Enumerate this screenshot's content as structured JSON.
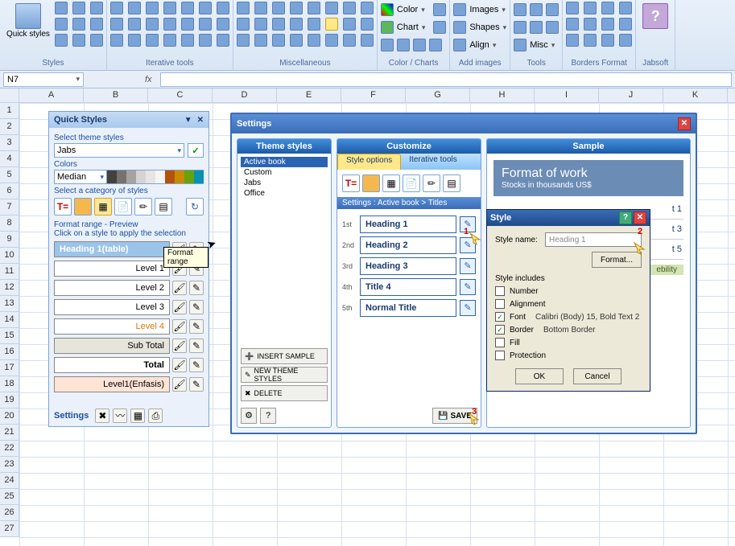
{
  "ribbon": {
    "groups": [
      {
        "label": "Styles",
        "big": "Quick styles"
      },
      {
        "label": "Iterative tools"
      },
      {
        "label": "Miscellaneous"
      },
      {
        "label": "Color / Charts",
        "rows": [
          "Color",
          "Chart",
          "Align"
        ]
      },
      {
        "label": "Add images",
        "rows": [
          "Images",
          "Shapes",
          "Align"
        ]
      },
      {
        "label": "Tools",
        "rows": [
          "Misc"
        ]
      },
      {
        "label": "Borders Format"
      },
      {
        "label": "Jabsoft"
      }
    ]
  },
  "formula": {
    "cell": "N7",
    "fx": "fx"
  },
  "grid": {
    "cols": [
      "A",
      "B",
      "C",
      "D",
      "E",
      "F",
      "G",
      "H",
      "I",
      "J",
      "K"
    ],
    "rows": 27
  },
  "quickStyles": {
    "title": "Quick Styles",
    "select_theme_label": "Select theme styles",
    "theme_value": "Jabs",
    "colors_label": "Colors",
    "colors_value": "Median",
    "swatches": [
      "#44403c",
      "#78716c",
      "#a8a29e",
      "#d6d3d1",
      "#e7e5e4",
      "#f5f5f4",
      "#b45309",
      "#ca8a04",
      "#65a30d",
      "#0891b2"
    ],
    "category_label": "Select a category of styles",
    "tooltip": "Format range",
    "preview_label": "Format range - Preview",
    "preview_sub": "Click on a style to apply the selection",
    "styles": [
      {
        "name": "Heading 1(table)",
        "sel": true,
        "bg": "#9cc3e8",
        "color": "#fff",
        "align": "left",
        "bold": true
      },
      {
        "name": "Level 1",
        "bg": "#fff",
        "color": "#000"
      },
      {
        "name": "Level 2",
        "bg": "#fff",
        "color": "#000"
      },
      {
        "name": "Level 3",
        "bg": "#fff",
        "color": "#000"
      },
      {
        "name": "Level 4",
        "bg": "#fff",
        "color": "#d97706"
      },
      {
        "name": "Sub Total",
        "bg": "#e5e5dc",
        "color": "#000"
      },
      {
        "name": "Total",
        "bg": "#fff",
        "color": "#000",
        "bold": true
      },
      {
        "name": "Level1(Enfasis)",
        "bg": "#ffe4d6",
        "color": "#000"
      }
    ],
    "settings_label": "Settings"
  },
  "settings": {
    "title": "Settings",
    "panes": {
      "left": "Theme styles",
      "mid": "Customize",
      "right": "Sample"
    },
    "themes": [
      "Active book",
      "Custom",
      "Jabs",
      "Office"
    ],
    "left_buttons": [
      "INSERT SAMPLE",
      "NEW THEME STYLES",
      "DELETE"
    ],
    "tabs": [
      "Style options",
      "Iterative tools"
    ],
    "breadcrumb": "Settings : Active book > Titles",
    "headings": [
      {
        "ord": "1st",
        "val": "Heading 1"
      },
      {
        "ord": "2nd",
        "val": "Heading 2"
      },
      {
        "ord": "3rd",
        "val": "Heading 3"
      },
      {
        "ord": "4th",
        "val": "Title 4"
      },
      {
        "ord": "5th",
        "val": "Normal Title"
      }
    ],
    "save": "SAVE",
    "sample": {
      "title": "Format of work",
      "subtitle": "Stocks in thousands US$",
      "rows": [
        "t 1",
        "t 3",
        "t 5"
      ],
      "tag": "ebility"
    }
  },
  "styleDialog": {
    "title": "Style",
    "name_label": "Style name:",
    "name_value": "Heading 1",
    "format_btn": "Format...",
    "includes_label": "Style includes",
    "checks": [
      {
        "label": "Number",
        "on": false,
        "val": ""
      },
      {
        "label": "Alignment",
        "on": false,
        "val": ""
      },
      {
        "label": "Font",
        "on": true,
        "val": "Calibri (Body) 15, Bold Text 2"
      },
      {
        "label": "Border",
        "on": true,
        "val": "Bottom Border"
      },
      {
        "label": "Fill",
        "on": false,
        "val": ""
      },
      {
        "label": "Protection",
        "on": false,
        "val": ""
      }
    ],
    "ok": "OK",
    "cancel": "Cancel"
  },
  "callouts": {
    "c1": "1",
    "c2": "2",
    "c3": "3"
  }
}
